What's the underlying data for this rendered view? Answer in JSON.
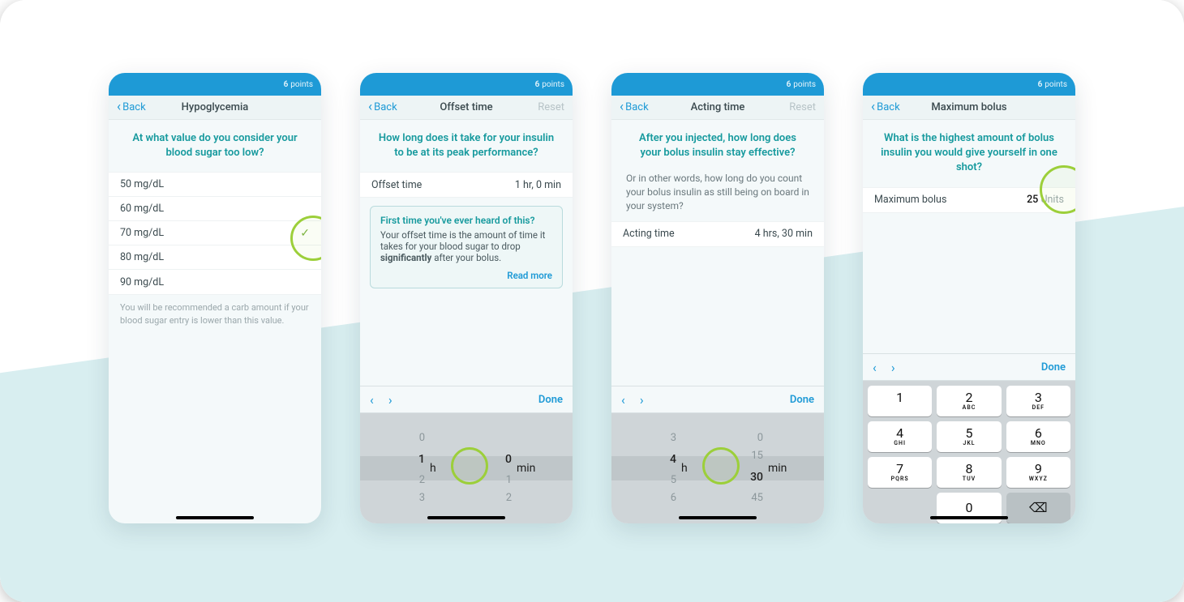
{
  "points_label": "points",
  "points_value": "6",
  "back_label": "Back",
  "done_label": "Done",
  "reset_label": "Reset",
  "screen1": {
    "title": "Hypoglycemia",
    "question": "At what value do you consider your blood sugar too low?",
    "options": [
      "50 mg/dL",
      "60 mg/dL",
      "70 mg/dL",
      "80 mg/dL",
      "90 mg/dL"
    ],
    "selected_index": 2,
    "helper": "You will be recommended a carb amount if your blood sugar entry is lower than this value."
  },
  "screen2": {
    "title": "Offset time",
    "question": "How long does it take for your insulin to be at its peak performance?",
    "row_label": "Offset time",
    "row_value": "1 hr, 0 min",
    "info_title": "First time you've ever heard of this?",
    "info_body_1": "Your offset time is the amount of time it takes for your blood sugar to drop ",
    "info_body_bold": "significantly",
    "info_body_2": " after your bolus.",
    "read_more": "Read more",
    "picker": {
      "h_prev": "0",
      "h_sel": "1",
      "h_next": "2",
      "h_next2": "3",
      "h_lbl": "h",
      "m_sel": "0",
      "m_next": "1",
      "m_next2": "2",
      "m_lbl": "min"
    }
  },
  "screen3": {
    "title": "Acting time",
    "question": "After you injected, how long does your bolus insulin stay effective?",
    "sub": "Or in other words, how long do you count your bolus insulin as still being on board in your system?",
    "row_label": "Acting time",
    "row_value": "4 hrs, 30 min",
    "picker": {
      "h_prev": "3",
      "h_sel": "4",
      "h_next": "5",
      "h_next2": "6",
      "h_lbl": "h",
      "m_prev": "0",
      "m_prev2": "15",
      "m_sel": "30",
      "m_next": "45",
      "m_lbl": "min"
    }
  },
  "screen4": {
    "title": "Maximum bolus",
    "question": "What is the highest amount of bolus insulin you would give yourself in one shot?",
    "row_label": "Maximum bolus",
    "row_value": "25",
    "row_unit": "Units",
    "keys": {
      "k1": "1",
      "k2": "2",
      "k2s": "ABC",
      "k3": "3",
      "k3s": "DEF",
      "k4": "4",
      "k4s": "GHI",
      "k5": "5",
      "k5s": "JKL",
      "k6": "6",
      "k6s": "MNO",
      "k7": "7",
      "k7s": "PQRS",
      "k8": "8",
      "k8s": "TUV",
      "k9": "9",
      "k9s": "WXYZ",
      "k0": "0"
    }
  }
}
